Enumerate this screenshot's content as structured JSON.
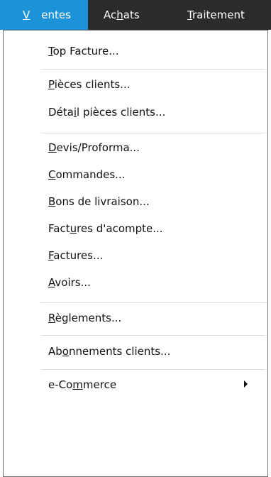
{
  "menubar": {
    "items": [
      {
        "id": "ventes",
        "pre": "",
        "u": "V",
        "post": "entes"
      },
      {
        "id": "achats",
        "pre": "Ac",
        "u": "h",
        "post": "ats"
      },
      {
        "id": "traitement",
        "pre": "",
        "u": "T",
        "post": "raitement"
      }
    ]
  },
  "menu": {
    "items": [
      {
        "pre": "",
        "u": "T",
        "post": "op Facture..."
      },
      {
        "pre": "",
        "u": "P",
        "post": "ièces clients..."
      },
      {
        "pre": "Déta",
        "u": "i",
        "post": "l pièces clients..."
      },
      {
        "pre": "",
        "u": "D",
        "post": "evis/Proforma..."
      },
      {
        "pre": "",
        "u": "C",
        "post": "ommandes..."
      },
      {
        "pre": "",
        "u": "B",
        "post": "ons de livraison..."
      },
      {
        "pre": "Fact",
        "u": "u",
        "post": "res d'acompte..."
      },
      {
        "pre": "",
        "u": "F",
        "post": "actures..."
      },
      {
        "pre": "",
        "u": "A",
        "post": "voirs..."
      },
      {
        "pre": "",
        "u": "R",
        "post": "èglements..."
      },
      {
        "pre": "Ab",
        "u": "o",
        "post": "nnements clients..."
      },
      {
        "pre": "e-Co",
        "u": "m",
        "post": "merce"
      }
    ]
  }
}
